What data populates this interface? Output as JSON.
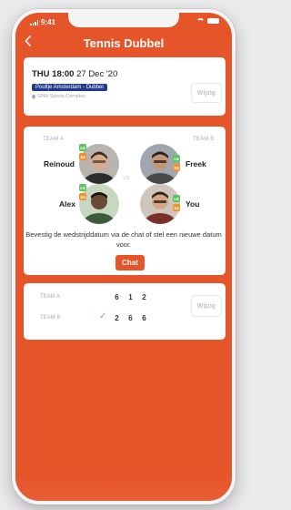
{
  "status_bar": {
    "time": "9:41"
  },
  "header": {
    "back_icon": "chevron-left-icon",
    "title": "Tennis Dubbel"
  },
  "match": {
    "day_time": "THU 18:00",
    "date": "27 Dec '20",
    "league": "Poultje Amsterdam - Dubbel",
    "venue": "GNH Sports Complex",
    "edit_label": "Wijzig"
  },
  "teams": {
    "team_a_label": "TEAM A",
    "team_b_label": "TEAM B",
    "vs_label": "VS",
    "team_a_players": [
      {
        "name": "Reinoud",
        "badges": [
          "L6",
          "S4"
        ]
      },
      {
        "name": "Alex",
        "badges": [
          "L6",
          "S4"
        ]
      }
    ],
    "team_b_players": [
      {
        "name": "Freek",
        "badges": [
          "L6",
          "S4"
        ]
      },
      {
        "name": "You",
        "badges": [
          "L6",
          "S4"
        ]
      }
    ],
    "hint": "Bevestig de wedstrijddatum via de chat of stel een nieuwe datum voor.",
    "chat_label": "Chat"
  },
  "score": {
    "team_a_label": "TEAM A",
    "team_b_label": "TEAM B",
    "team_a_sets": [
      "6",
      "1",
      "2"
    ],
    "team_b_sets": [
      "2",
      "6",
      "6"
    ],
    "winner_icon": "check-icon",
    "edit_label": "Wijzig"
  },
  "colors": {
    "accent": "#e6542a",
    "league_tag": "#233a8c",
    "badge_green": "#5ec45c",
    "badge_orange": "#f2922e"
  }
}
